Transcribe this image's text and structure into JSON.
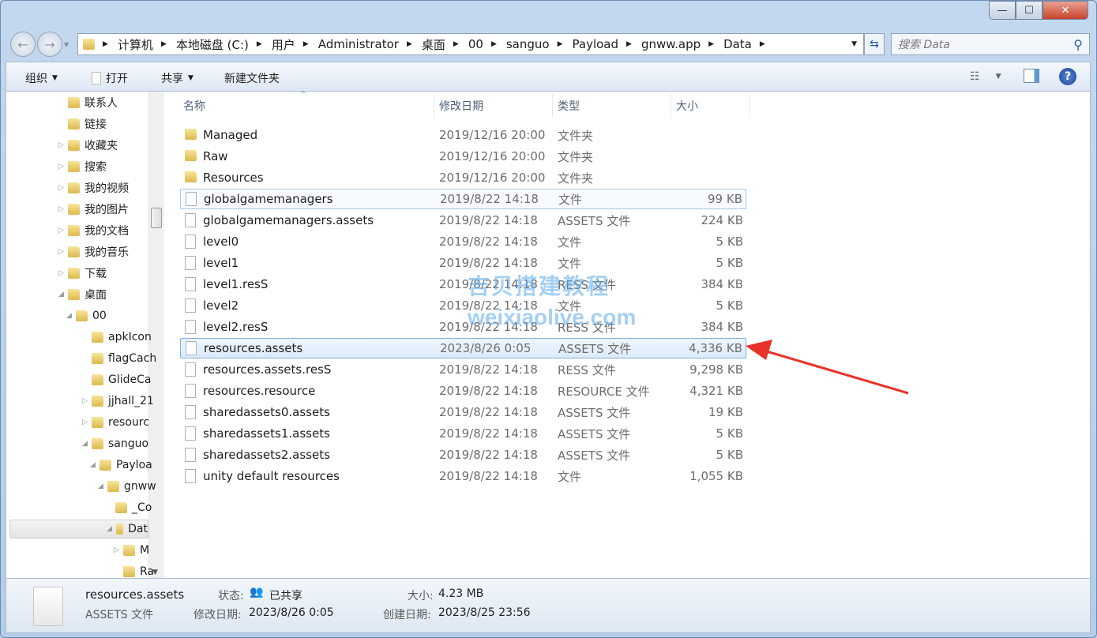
{
  "window": {
    "controls": {
      "minimize": "—",
      "maximize": "☐",
      "close": "✕"
    }
  },
  "address": {
    "segments": [
      "计算机",
      "本地磁盘 (C:)",
      "用户",
      "Administrator",
      "桌面",
      "00",
      "sanguo",
      "Payload",
      "gnww.app",
      "Data"
    ]
  },
  "search": {
    "placeholder": "搜索 Data"
  },
  "toolbar": {
    "organize": "组织",
    "open": "打开",
    "share": "共享",
    "new_folder": "新建文件夹"
  },
  "tree": [
    {
      "label": "联系人",
      "level": 0,
      "tw": ""
    },
    {
      "label": "链接",
      "level": 0,
      "tw": ""
    },
    {
      "label": "收藏夹",
      "level": 0,
      "tw": "closed"
    },
    {
      "label": "搜索",
      "level": 0,
      "tw": "closed"
    },
    {
      "label": "我的视频",
      "level": 0,
      "tw": "closed"
    },
    {
      "label": "我的图片",
      "level": 0,
      "tw": "closed"
    },
    {
      "label": "我的文档",
      "level": 0,
      "tw": "closed"
    },
    {
      "label": "我的音乐",
      "level": 0,
      "tw": "closed"
    },
    {
      "label": "下载",
      "level": 0,
      "tw": "closed"
    },
    {
      "label": "桌面",
      "level": 0,
      "tw": "open"
    },
    {
      "label": "00",
      "level": 1,
      "tw": "open"
    },
    {
      "label": "apkIcon",
      "level": 2,
      "tw": ""
    },
    {
      "label": "flagCach",
      "level": 2,
      "tw": ""
    },
    {
      "label": "GlideCa",
      "level": 2,
      "tw": ""
    },
    {
      "label": "jjhall_21",
      "level": 2,
      "tw": "closed"
    },
    {
      "label": "resourc",
      "level": 2,
      "tw": "closed"
    },
    {
      "label": "sanguo",
      "level": 2,
      "tw": "open"
    },
    {
      "label": "Payloa",
      "level": 3,
      "tw": "open"
    },
    {
      "label": "gnww",
      "level": 4,
      "tw": "open"
    },
    {
      "label": "_Co",
      "level": 5,
      "tw": ""
    },
    {
      "label": "Dat",
      "level": 5,
      "tw": "open",
      "selected": true
    },
    {
      "label": "M",
      "level": 6,
      "tw": "closed"
    },
    {
      "label": "Ra",
      "level": 6,
      "tw": ""
    }
  ],
  "columns": {
    "name": "名称",
    "date": "修改日期",
    "type": "类型",
    "size": "大小"
  },
  "files": [
    {
      "name": "Managed",
      "date": "2019/12/16 20:00",
      "type": "文件夹",
      "size": "",
      "folder": true
    },
    {
      "name": "Raw",
      "date": "2019/12/16 20:00",
      "type": "文件夹",
      "size": "",
      "folder": true
    },
    {
      "name": "Resources",
      "date": "2019/12/16 20:00",
      "type": "文件夹",
      "size": "",
      "folder": true
    },
    {
      "name": "globalgamemanagers",
      "date": "2019/8/22 14:18",
      "type": "文件",
      "size": "99 KB",
      "state": "hover"
    },
    {
      "name": "globalgamemanagers.assets",
      "date": "2019/8/22 14:18",
      "type": "ASSETS 文件",
      "size": "224 KB"
    },
    {
      "name": "level0",
      "date": "2019/8/22 14:18",
      "type": "文件",
      "size": "5 KB"
    },
    {
      "name": "level1",
      "date": "2019/8/22 14:18",
      "type": "文件",
      "size": "5 KB"
    },
    {
      "name": "level1.resS",
      "date": "2019/8/22 14:18",
      "type": "RESS 文件",
      "size": "384 KB"
    },
    {
      "name": "level2",
      "date": "2019/8/22 14:18",
      "type": "文件",
      "size": "5 KB"
    },
    {
      "name": "level2.resS",
      "date": "2019/8/22 14:18",
      "type": "RESS 文件",
      "size": "384 KB"
    },
    {
      "name": "resources.assets",
      "date": "2023/8/26 0:05",
      "type": "ASSETS 文件",
      "size": "4,336 KB",
      "state": "selected"
    },
    {
      "name": "resources.assets.resS",
      "date": "2019/8/22 14:18",
      "type": "RESS 文件",
      "size": "9,298 KB"
    },
    {
      "name": "resources.resource",
      "date": "2019/8/22 14:18",
      "type": "RESOURCE 文件",
      "size": "4,321 KB"
    },
    {
      "name": "sharedassets0.assets",
      "date": "2019/8/22 14:18",
      "type": "ASSETS 文件",
      "size": "19 KB"
    },
    {
      "name": "sharedassets1.assets",
      "date": "2019/8/22 14:18",
      "type": "ASSETS 文件",
      "size": "5 KB"
    },
    {
      "name": "sharedassets2.assets",
      "date": "2019/8/22 14:18",
      "type": "ASSETS 文件",
      "size": "5 KB"
    },
    {
      "name": "unity default resources",
      "date": "2019/8/22 14:18",
      "type": "文件",
      "size": "1,055 KB"
    }
  ],
  "watermark": {
    "line1": "吉贝搭建教程",
    "line2": "weixiaolive.com"
  },
  "annotation": {
    "arrow_color": "#e8332a"
  },
  "details": {
    "name": "resources.assets",
    "type": "ASSETS 文件",
    "state_label": "状态:",
    "state_value": "已共享",
    "modified_label": "修改日期:",
    "modified_value": "2023/8/26 0:05",
    "size_label": "大小:",
    "size_value": "4.23 MB",
    "created_label": "创建日期:",
    "created_value": "2023/8/25 23:56"
  }
}
